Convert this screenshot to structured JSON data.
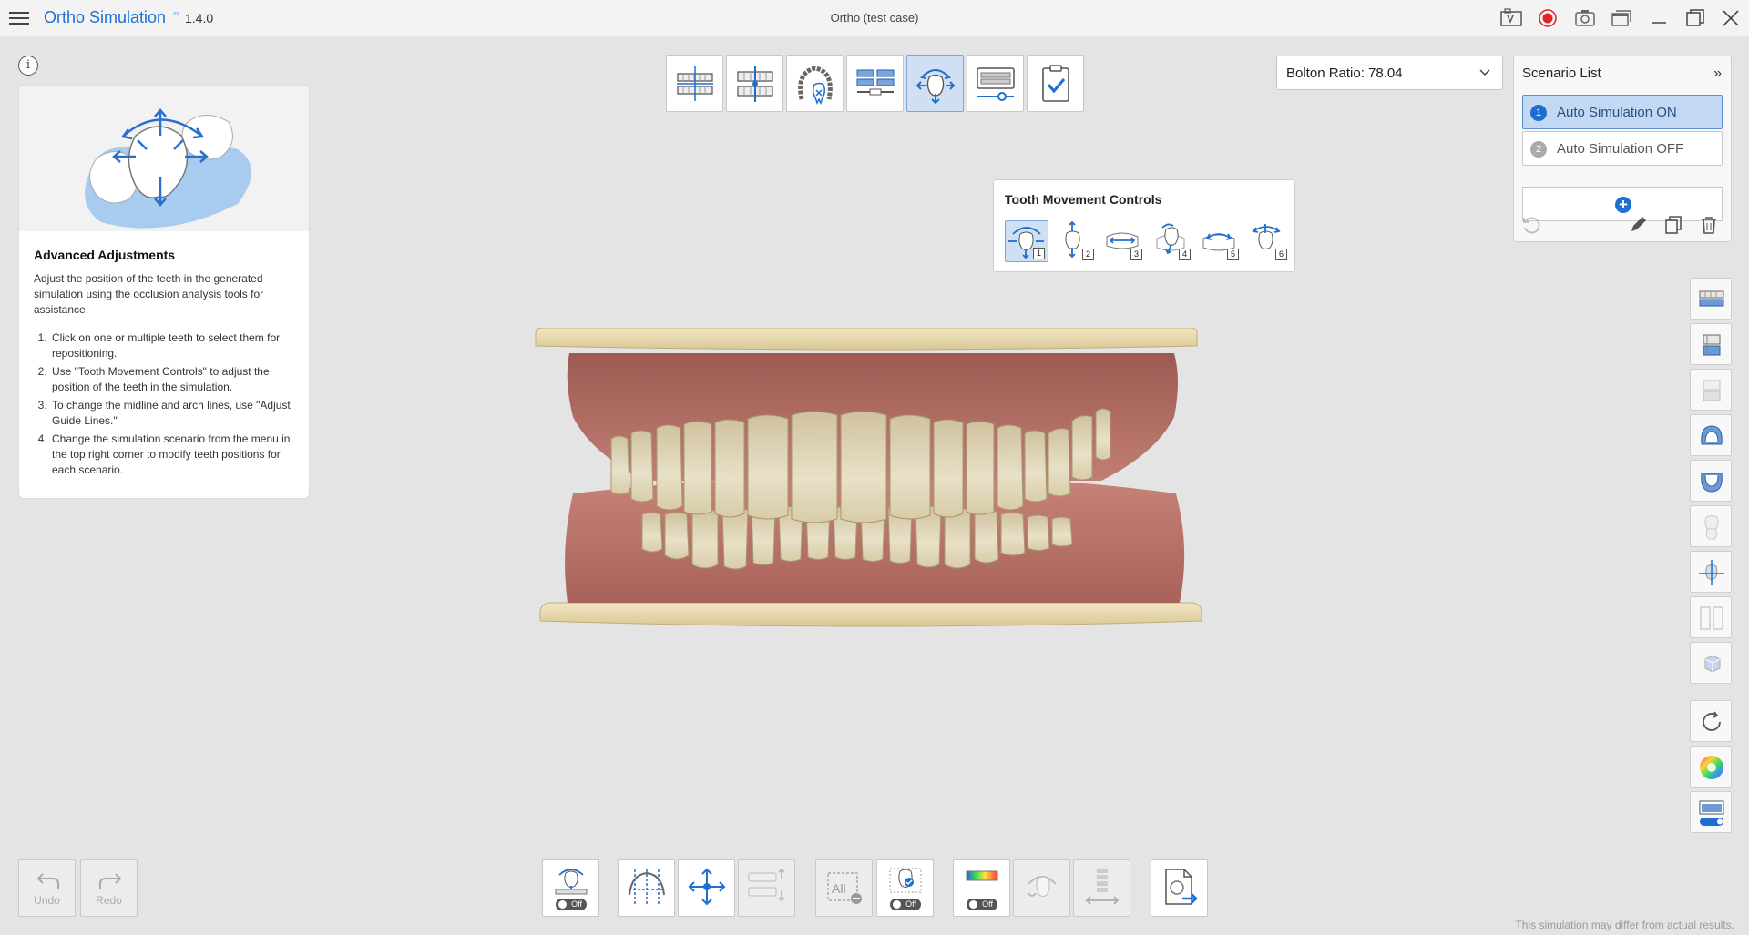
{
  "titlebar": {
    "app_name": "Ortho Simulation",
    "version": "1.4.0",
    "case_title": "Ortho (test case)"
  },
  "guide": {
    "title": "Advanced Adjustments",
    "description": "Adjust the position of the teeth in the generated simulation using the occlusion analysis tools for assistance.",
    "steps": [
      "Click on one or multiple teeth to select them for repositioning.",
      "Use \"Tooth Movement Controls\" to adjust the position of the teeth in the simulation.",
      "To change the midline and arch lines, use \"Adjust Guide Lines.\"",
      "Change the simulation scenario from the menu in the top right corner to modify teeth positions for each scenario."
    ]
  },
  "bolton": {
    "label": "Bolton Ratio: 78.04"
  },
  "scenario": {
    "title": "Scenario List",
    "items": [
      {
        "num": "1",
        "label": "Auto Simulation ON"
      },
      {
        "num": "2",
        "label": "Auto Simulation OFF"
      }
    ],
    "add_symbol": "+"
  },
  "tooth_movement": {
    "title": "Tooth Movement Controls",
    "buttons": [
      "1",
      "2",
      "3",
      "4",
      "5",
      "6"
    ]
  },
  "bottom": {
    "undo": "Undo",
    "redo": "Redo",
    "off": "Off",
    "all": "All"
  },
  "disclaimer": "This simulation may differ from actual results.",
  "colors": {
    "accent": "#1f6fd1",
    "active_bg": "#cfe0f5",
    "record_red": "#e0242a"
  },
  "icons": {
    "titlebar": [
      "menu-icon",
      "camera-compare-icon",
      "record-icon",
      "screenshot-icon",
      "window-capture-icon",
      "minimize-icon",
      "maximize-icon",
      "close-icon"
    ],
    "top_toolbar": [
      "occlusion-view-icon",
      "upper-lower-align-icon",
      "arch-tooth-icon",
      "jaw-align-icon",
      "tooth-movement-icon",
      "model-base-icon",
      "complete-check-icon"
    ],
    "right_toolbar": [
      "upper-jaw-front-icon",
      "jaw-left-icon",
      "jaw-right-icon",
      "upper-arch-icon",
      "lower-arch-icon",
      "tooth-ghost-icon",
      "axis-icon",
      "split-view-icon",
      "cube-view-icon",
      "rotate-icon",
      "color-wheel-icon",
      "simulation-toggle-icon"
    ]
  }
}
